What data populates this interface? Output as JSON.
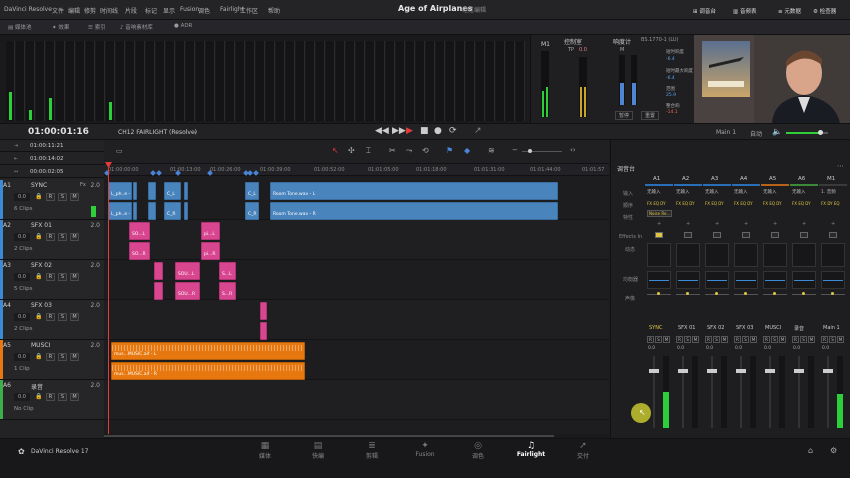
{
  "app": {
    "name": "DaVinci Resolve",
    "project_title": "Age of Airplanes",
    "project_subtitle": "经过编辑",
    "bottom_name": "DaVinci Resolve 17"
  },
  "menu": [
    "文件",
    "编辑",
    "修剪",
    "时间线",
    "片段",
    "标记",
    "显示",
    "Fusion",
    "调色",
    "Fairlight",
    "工作区",
    "帮助"
  ],
  "toolbar_left": [
    "媒体池",
    "效果",
    "索引",
    "音响素材库",
    "自动化",
    "ADR"
  ],
  "toolbar_right": [
    "调音台",
    "音频表",
    "元数据",
    "检查器"
  ],
  "meters_panel": {
    "m1_label": "M1",
    "control_room": "控制室",
    "tp_label": "TP",
    "tp_value": "0.0",
    "loudness_label": "响度计",
    "loudness_standard": "BS.1770-1 (LU)",
    "m_label": "M",
    "short_term_label": "短时响度",
    "short_term_value": "-6.4",
    "short_max_label": "短时最大响度",
    "short_max_value": "-6.4",
    "range_label": "范围",
    "range_value": "25.9",
    "integrated_label": "整合响",
    "integrated_value": "-14.1",
    "pause_button": "暂停",
    "reset_button": "重置"
  },
  "transport": {
    "timecode": "01:00:01:16",
    "timeline_name": "CH12 FAIRLIGHT (Resolve)",
    "tc_in": "01:00:11:21",
    "tc_out": "01:00:14:02",
    "tc_cursor": "00:00:02:05",
    "main_label": "Main 1",
    "auto_label": "自动"
  },
  "ruler_ticks": [
    "01:00:00:00",
    "01:00:13:00",
    "01:00:26:00",
    "01:00:39:00",
    "01:00:52:00",
    "01:01:05:00",
    "01:01:18:00",
    "01:01:31:00",
    "01:01:44:00",
    "01:01:57"
  ],
  "tracks": [
    {
      "num": "A1",
      "name": "SYNC",
      "fx": "Fx",
      "vol": "2.0",
      "field": "0.0",
      "clips": "6 Clips",
      "color": "#3c8ad6"
    },
    {
      "num": "A2",
      "name": "SFX 01",
      "fx": "",
      "vol": "2.0",
      "field": "0.0",
      "clips": "2 Clips",
      "color": "#3c8ad6"
    },
    {
      "num": "A3",
      "name": "SFX 02",
      "fx": "",
      "vol": "2.0",
      "field": "0.0",
      "clips": "5 Clips",
      "color": "#3c8ad6"
    },
    {
      "num": "A4",
      "name": "SFX 03",
      "fx": "",
      "vol": "2.0",
      "field": "0.0",
      "clips": "2 Clips",
      "color": "#3c8ad6"
    },
    {
      "num": "A5",
      "name": "MUSCI",
      "fx": "",
      "vol": "2.0",
      "field": "0.0",
      "clips": "1 Clip",
      "color": "#e6780f"
    },
    {
      "num": "A6",
      "name": "录音",
      "fx": "",
      "vol": "2.0",
      "field": "0.0",
      "clips": "No Clip",
      "color": "#3cae4a"
    }
  ],
  "track_buttons": [
    "R",
    "S",
    "M"
  ],
  "clip_labels": {
    "sync_l": "Room Tone.wav - L",
    "sync_r": "Room Tone.wav - R",
    "sync_small_l": "L_ph..e - L",
    "sync_small_r": "L_ph..e - R",
    "sfx1_a": "SO...L",
    "sfx1_b": "SO...R",
    "sfx1_c": "pi...L",
    "sfx1_d": "pi...R",
    "sfx2_a": "SOU...L",
    "sfx2_b": "SOU...R",
    "sfx2_c": "S...L",
    "sfx2_d": "S...R",
    "music_l": "mus...MUSIC.aif - L",
    "music_r": "mus...MUSIC.aif - R",
    "c_l": "C_L",
    "c_r": "C_R"
  },
  "mixer": {
    "title": "调音台",
    "columns": [
      "A1",
      "A2",
      "A3",
      "A4",
      "A5",
      "A6",
      "M1"
    ],
    "row_input": "输入",
    "row_order": "顺序",
    "row_effects": "特性",
    "row_effects_in": "Effects In",
    "row_dynamics": "动态",
    "row_eq": "均衡器",
    "row_pan": "声像",
    "input_values": [
      "无输入",
      "无输入",
      "无输入",
      "无输入",
      "无输入",
      "无输入",
      "1. 音频"
    ],
    "order_values": [
      "FX EQ DY",
      "FX EQ DY",
      "FX EQ DY",
      "FX EQ DY",
      "FX EQ DY",
      "FX EQ DY",
      "FX DY EQ"
    ],
    "effects_value": "Noise Re...",
    "fader_names": [
      "SYNC",
      "SFX 01",
      "SFX 02",
      "SFX 03",
      "MUSCI",
      "录音",
      "Main 1"
    ],
    "fader_values": [
      "0.0",
      "0.0",
      "0.0",
      "0.0",
      "0.0",
      "0.0",
      "0.0"
    ]
  },
  "pages": [
    "媒体",
    "快编",
    "剪辑",
    "Fusion",
    "调色",
    "Fairlight",
    "交付"
  ],
  "active_page": "Fairlight",
  "colors": {
    "blue_clip": "#4a84bd",
    "pink_clip": "#d8468f",
    "orange_clip": "#e6780f",
    "playhead": "#e23b3b",
    "active_page": "#ffffff"
  }
}
